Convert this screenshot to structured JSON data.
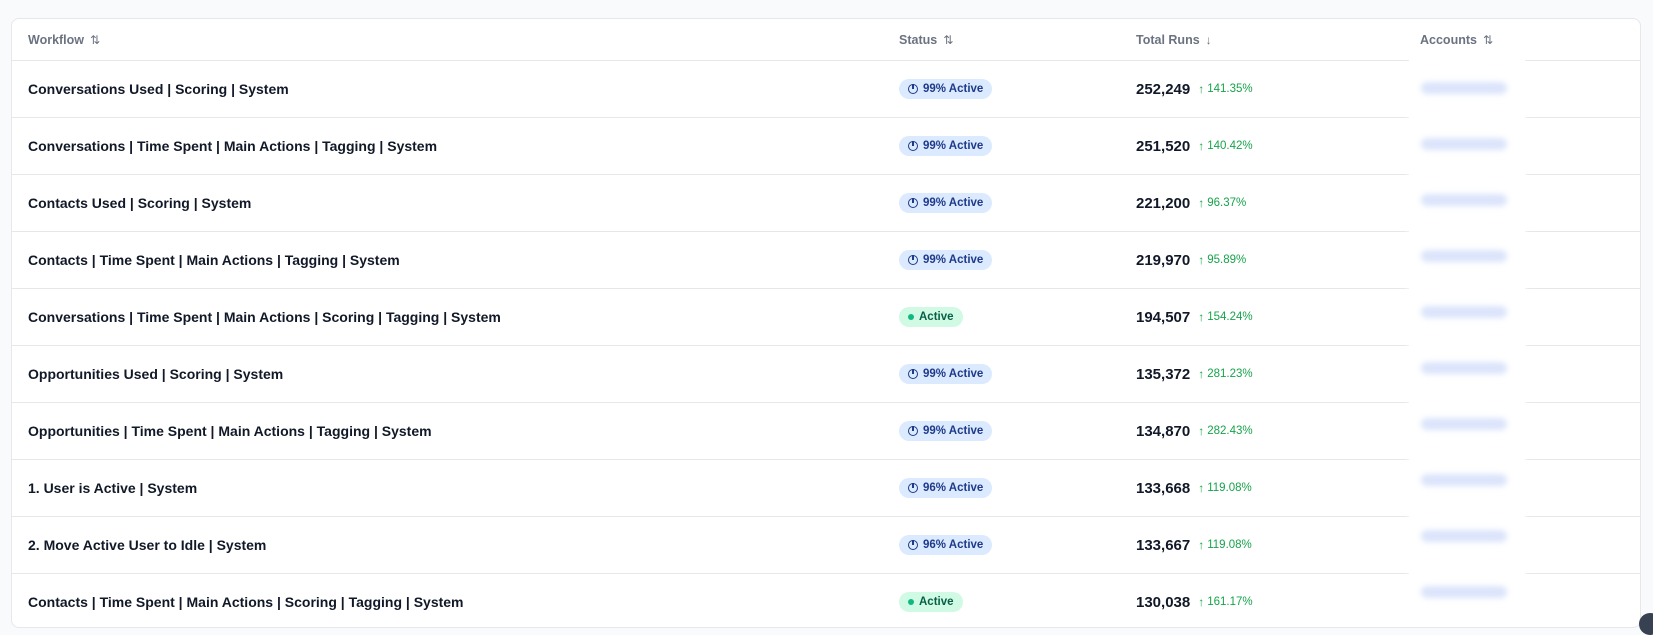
{
  "table": {
    "columns": {
      "workflow": "Workflow",
      "status": "Status",
      "total_runs": "Total Runs",
      "accounts": "Accounts"
    },
    "sort_icons": {
      "workflow": "⇅",
      "status": "⇅",
      "total_runs": "↓",
      "accounts": "⇅"
    },
    "rows": [
      {
        "workflow": "Conversations Used | Scoring | System",
        "status": "99% Active",
        "status_type": "partial",
        "runs": "252,249",
        "trend": "141.35%"
      },
      {
        "workflow": "Conversations | Time Spent | Main Actions | Tagging | System",
        "status": "99% Active",
        "status_type": "partial",
        "runs": "251,520",
        "trend": "140.42%"
      },
      {
        "workflow": "Contacts Used | Scoring | System",
        "status": "99% Active",
        "status_type": "partial",
        "runs": "221,200",
        "trend": "96.37%"
      },
      {
        "workflow": "Contacts | Time Spent | Main Actions | Tagging | System",
        "status": "99% Active",
        "status_type": "partial",
        "runs": "219,970",
        "trend": "95.89%"
      },
      {
        "workflow": "Conversations | Time Spent | Main Actions | Scoring | Tagging | System",
        "status": "Active",
        "status_type": "full",
        "runs": "194,507",
        "trend": "154.24%"
      },
      {
        "workflow": "Opportunities Used | Scoring | System",
        "status": "99% Active",
        "status_type": "partial",
        "runs": "135,372",
        "trend": "281.23%"
      },
      {
        "workflow": "Opportunities | Time Spent | Main Actions | Tagging | System",
        "status": "99% Active",
        "status_type": "partial",
        "runs": "134,870",
        "trend": "282.43%"
      },
      {
        "workflow": "1. User is Active | System",
        "status": "96% Active",
        "status_type": "partial",
        "runs": "133,668",
        "trend": "119.08%"
      },
      {
        "workflow": "2. Move Active User to Idle | System",
        "status": "96% Active",
        "status_type": "partial",
        "runs": "133,667",
        "trend": "119.08%"
      },
      {
        "workflow": "Contacts | Time Spent | Main Actions | Scoring | Tagging | System",
        "status": "Active",
        "status_type": "full",
        "runs": "130,038",
        "trend": "161.17%"
      }
    ]
  },
  "icons": {
    "partial_status": "pie-chart-icon",
    "full_status": "dot-icon",
    "trend": "arrow-up-icon"
  },
  "colors": {
    "partial_badge_bg": "#dbeafe",
    "partial_badge_text": "#1e3a8a",
    "full_badge_bg": "#d1fae5",
    "full_badge_text": "#065f46",
    "trend_up": "#16a34a"
  }
}
